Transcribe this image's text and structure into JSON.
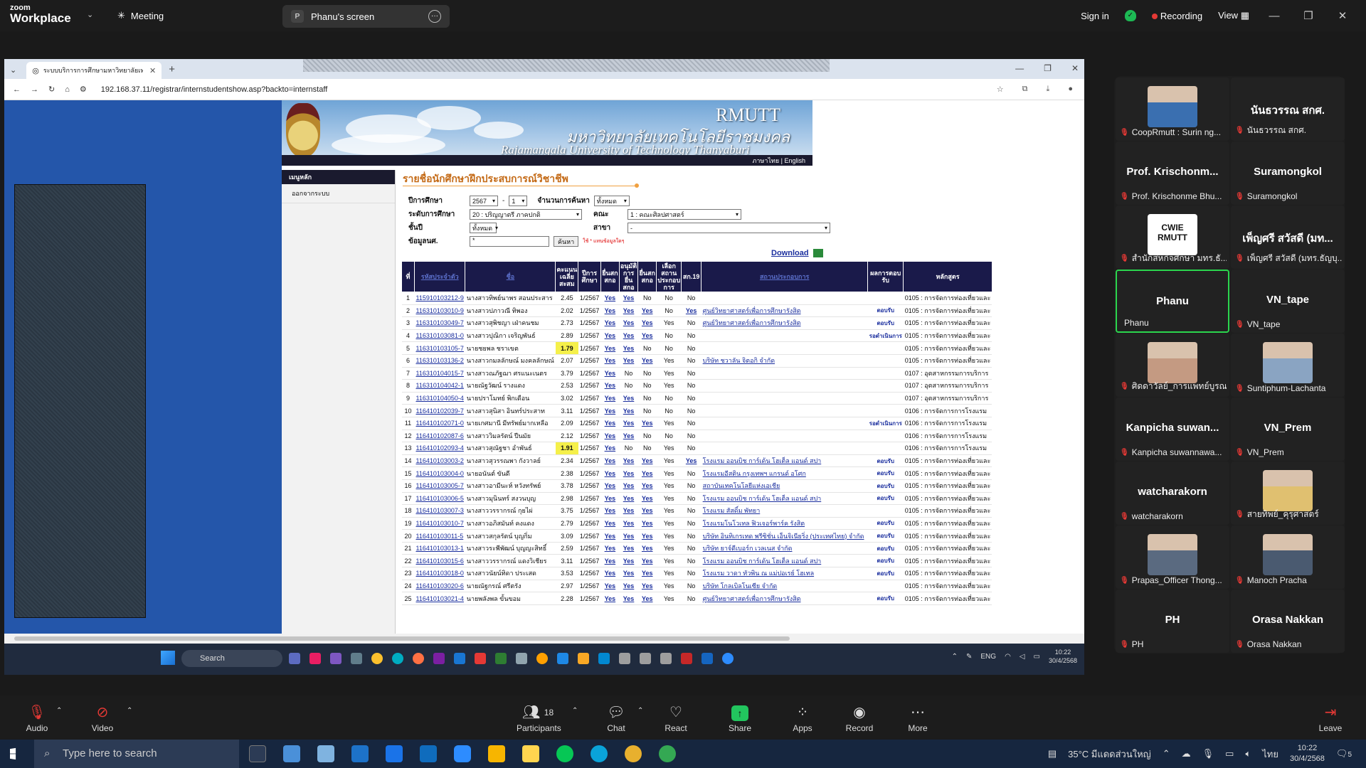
{
  "zoom": {
    "brand_top": "zoom",
    "brand_bottom": "Workplace",
    "meeting_label": "Meeting",
    "share_badge": "P",
    "share_title": "Phanu's screen",
    "signin": "Sign in",
    "recording": "Recording",
    "view": "View",
    "controls": {
      "audio": "Audio",
      "video": "Video",
      "participants": "Participants",
      "participants_count": "18",
      "chat": "Chat",
      "react": "React",
      "share": "Share",
      "apps": "Apps",
      "record": "Record",
      "more": "More",
      "leave": "Leave"
    }
  },
  "browser": {
    "tab_title": "ระบบบริการการศึกษามหาวิทยาลัยเทคโ...",
    "url": "192.168.37.11/registrar/internstudentshow.asp?backto=internstaff"
  },
  "site": {
    "brand_en": "RMUTT",
    "brand_th": "มหาวิทยาลัยเทคโนโลยีราชมงคลธัญบุรี",
    "brand_full": "Rajamangala University of Technology Thanyaburi",
    "nav_lang": "ภาษาไทย | English",
    "menu_main": "เมนูหลัก",
    "menu_logout": "ออกจากระบบ",
    "page_title": "รายชื่อนักศึกษาฝึกประสบการณ์วิชาชีพ",
    "form": {
      "year_label": "ปีการศึกษา",
      "year": "2567",
      "sem": "1",
      "count_label": "จำนวนการค้นหา",
      "count": "ทั้งหมด",
      "level_label": "ระดับการศึกษา",
      "level": "20 : ปริญญาตรี ภาคปกติ",
      "faculty_label": "คณะ",
      "faculty": "1 : คณะศิลปศาสตร์",
      "grade_label": "ชั้นปี",
      "grade": "ทั้งหมด",
      "major_label": "สาขา",
      "major": "-",
      "info_label": "ข้อมูลนศ.",
      "info_value": "*",
      "search_btn": "ค้นหา",
      "note": "ใช้ * แทนข้อมูลใดๆ"
    },
    "download": "Download",
    "table": {
      "headers": [
        "ที่",
        "รหัสประจำตัว",
        "ชื่อ",
        "คะแนนเฉลี่ยสะสม",
        "ปีการศึกษา",
        "ยื่นสกสกอ",
        "อนุมัติการยื่นสกอ",
        "ยื่นสกสกอ",
        "เลือกสถานประกอบการ",
        "สก.19",
        "สถานประกอบการ",
        "ผลการตอบรับ",
        "หลักสูตร"
      ],
      "rows": [
        [
          "1",
          "115910103212-9",
          "นางสาวทิพย์นาพร สอนประสาร",
          "2.45",
          "1/2567",
          "Yes",
          "Yes",
          "No",
          "No",
          "No",
          "",
          "",
          "0105 : การจัดการท่องเที่ยวและ"
        ],
        [
          "2",
          "116310103010-9",
          "นางสาวปภาวณี ทิพอง",
          "2.02",
          "1/2567",
          "Yes",
          "Yes",
          "Yes",
          "No",
          "Yes",
          "ศูนย์วิทยาศาสตร์เพื่อการศึกษารังสิต",
          "ตอบรับ",
          "0105 : การจัดการท่องเที่ยวและ"
        ],
        [
          "3",
          "116310103049-7",
          "นางสาวสุพิชญา เฝ่าคนชม",
          "2.73",
          "1/2567",
          "Yes",
          "Yes",
          "Yes",
          "Yes",
          "No",
          "ศูนย์วิทยาศาสตร์เพื่อการศึกษารังสิต",
          "ตอบรับ",
          "0105 : การจัดการท่องเที่ยวและ"
        ],
        [
          "4",
          "116310103081-0",
          "นางสาวปุณิกา เจริญพันธ์",
          "2.89",
          "1/2567",
          "Yes",
          "Yes",
          "Yes",
          "No",
          "No",
          "",
          "รอดำเนินการ",
          "0105 : การจัดการท่องเที่ยวและ"
        ],
        [
          "5",
          "116310103105-7",
          "นายชยพล ชราเขต",
          "1.79",
          "1/2567",
          "Yes",
          "Yes",
          "No",
          "No",
          "No",
          "",
          "",
          "0105 : การจัดการท่องเที่ยวและ"
        ],
        [
          "6",
          "116310103136-2",
          "นางสาวกมลลักษณ์ มงคลลักษณ์",
          "2.07",
          "1/2567",
          "Yes",
          "Yes",
          "Yes",
          "Yes",
          "No",
          "บริษัท ชวาลัน จิตอกิ จำกัด",
          "",
          "0105 : การจัดการท่องเที่ยวและ"
        ],
        [
          "7",
          "116310104015-7",
          "นางสาวณภัฐฌา ศรแนะเนตร",
          "3.79",
          "1/2567",
          "Yes",
          "No",
          "No",
          "Yes",
          "No",
          "",
          "",
          "0107 : อุตสาหกรรมการบริการ"
        ],
        [
          "8",
          "116310104042-1",
          "นายณัฐวัฒน์ รางแดง",
          "2.53",
          "1/2567",
          "Yes",
          "No",
          "No",
          "Yes",
          "No",
          "",
          "",
          "0107 : อุตสาหกรรมการบริการ"
        ],
        [
          "9",
          "116310104050-4",
          "นายปราโมทย์ พิกเดือน",
          "3.02",
          "1/2567",
          "Yes",
          "Yes",
          "No",
          "No",
          "No",
          "",
          "",
          "0107 : อุตสาหกรรมการบริการ"
        ],
        [
          "10",
          "116410102039-7",
          "นางสาวสุนิสา อินทร์ประสาท",
          "3.11",
          "1/2567",
          "Yes",
          "Yes",
          "No",
          "No",
          "No",
          "",
          "",
          "0106 : การจัดการการโรงแรม"
        ],
        [
          "11",
          "116410102071-0",
          "นายเกศมานี มีทรัพย์มากเหลือ",
          "2.09",
          "1/2567",
          "Yes",
          "Yes",
          "Yes",
          "Yes",
          "No",
          "",
          "รอดำเนินการ",
          "0106 : การจัดการการโรงแรม"
        ],
        [
          "12",
          "116410102087-6",
          "นางสาววิมลรัตน์ ปีนมัย",
          "2.12",
          "1/2567",
          "Yes",
          "Yes",
          "No",
          "No",
          "No",
          "",
          "",
          "0106 : การจัดการการโรงแรม"
        ],
        [
          "13",
          "116410102093-4",
          "นางสาวสุณัฐชา อำพันธ์",
          "1.91",
          "1/2567",
          "Yes",
          "No",
          "No",
          "Yes",
          "No",
          "",
          "",
          "0106 : การจัดการการโรงแรม"
        ],
        [
          "14",
          "116410103003-2",
          "นางสาวสุวรรณพา กังวาลย์",
          "2.34",
          "1/2567",
          "Yes",
          "Yes",
          "Yes",
          "Yes",
          "Yes",
          "โรงแรม ออนบิช การ์เด้น โฮเต็ล แอนด์ สปา",
          "ตอบรับ",
          "0105 : การจัดการท่องเที่ยวและ"
        ],
        [
          "15",
          "116410103004-0",
          "นายอนันต์ ขันดี",
          "2.38",
          "1/2567",
          "Yes",
          "Yes",
          "Yes",
          "Yes",
          "No",
          "โรงแรมอีสติน กรุงเทพฯ แกรนด์ อโศก",
          "ตอบรับ",
          "0105 : การจัดการท่องเที่ยวและ"
        ],
        [
          "16",
          "116410103005-7",
          "นางสาวอามีนะห์ หวังทรัพย์",
          "3.78",
          "1/2567",
          "Yes",
          "Yes",
          "Yes",
          "Yes",
          "No",
          "สถาบันเทคโนโลยีแห่งเอเชีย",
          "ตอบรับ",
          "0105 : การจัดการท่องเที่ยวและ"
        ],
        [
          "17",
          "116410103006-5",
          "นางสาวมุนินทร์ สงวนบุญ",
          "2.98",
          "1/2567",
          "Yes",
          "Yes",
          "Yes",
          "Yes",
          "No",
          "โรงแรม ออนบิช การ์เด้น โฮเต็ล แอนด์ สปา",
          "ตอบรับ",
          "0105 : การจัดการท่องเที่ยวและ"
        ],
        [
          "18",
          "116410103007-3",
          "นางสาววรรากรณ์ กุยไผ่",
          "3.75",
          "1/2567",
          "Yes",
          "Yes",
          "Yes",
          "Yes",
          "No",
          "โรงแรม สัสดิ์ม พัทยา",
          "",
          "0105 : การจัดการท่องเที่ยวและ"
        ],
        [
          "19",
          "116410103010-7",
          "นางสาวอภิสมันท์ คงแดง",
          "2.79",
          "1/2567",
          "Yes",
          "Yes",
          "Yes",
          "Yes",
          "No",
          "โรงแรมโนโวเทล ฟิวเจอร์พาร์ค รังสิต",
          "ตอบรับ",
          "0105 : การจัดการท่องเที่ยวและ"
        ],
        [
          "20",
          "116410103011-5",
          "นางสาวสกุลรัตน์ บุญกิ่ม",
          "3.09",
          "1/2567",
          "Yes",
          "Yes",
          "Yes",
          "Yes",
          "No",
          "บริษัท อินทิเกรเทด พรีซิชั่น เอ็นจิเนียริ่ง (ประเทศไทย) จำกัด",
          "ตอบรับ",
          "0105 : การจัดการท่องเที่ยวและ"
        ],
        [
          "21",
          "116410103013-1",
          "นางสาวระพีพัฒน์ บุญญะสิทธิ์",
          "2.59",
          "1/2567",
          "Yes",
          "Yes",
          "Yes",
          "Yes",
          "No",
          "บริษัท ยาจ์ดีเบอร์ก เวลเนส จำกัด",
          "ตอบรับ",
          "0105 : การจัดการท่องเที่ยวและ"
        ],
        [
          "22",
          "116410103015-6",
          "นางสาววรรากรณ์ แดงวิเชียร",
          "3.11",
          "1/2567",
          "Yes",
          "Yes",
          "Yes",
          "Yes",
          "No",
          "โรงแรม ออนบิช การ์เด้น โฮเต็ล แอนด์ สปา",
          "ตอบรับ",
          "0105 : การจัดการท่องเที่ยวและ"
        ],
        [
          "23",
          "116410103018-0",
          "นางสาวนัยน์ทิดา ประเสด",
          "3.53",
          "1/2567",
          "Yes",
          "Yes",
          "Yes",
          "Yes",
          "No",
          "โรงแรม วาดา ทัวพิน ณ แม่ปอเรย์ โฮเทล",
          "ตอบรับ",
          "0105 : การจัดการท่องเที่ยวและ"
        ],
        [
          "24",
          "116410103020-6",
          "นายณัฐกรณ์ ศรีตรัง",
          "2.97",
          "1/2567",
          "Yes",
          "Yes",
          "Yes",
          "Yes",
          "No",
          "บริษัท โกลเบิลโนเซีย จำกัด",
          "",
          "0105 : การจัดการท่องเที่ยวและ"
        ],
        [
          "25",
          "116410103021-4",
          "นายพลังพล ขั้นขอม",
          "2.28",
          "1/2567",
          "Yes",
          "Yes",
          "Yes",
          "Yes",
          "No",
          "ศูนย์วิทยาศาสตร์เพื่อการศึกษารังสิต",
          "ตอบรับ",
          "0105 : การจัดการท่องเที่ยวและ"
        ]
      ]
    }
  },
  "inner_taskbar": {
    "search": "Search",
    "lang": "ENG",
    "time": "10:22",
    "date": "30/4/2568"
  },
  "participants": [
    {
      "big": "",
      "name": "CoopRmutt : Surin ng...",
      "photo": "#3a6fb0"
    },
    {
      "big": "นันธวรรณ สกศ.",
      "name": "นันธวรรณ สกศ.",
      "photo": ""
    },
    {
      "big": "Prof. Krischonm...",
      "name": "Prof. Krischonme Bhu...",
      "photo": ""
    },
    {
      "big": "Suramongkol",
      "name": "Suramongkol",
      "photo": ""
    },
    {
      "big": "",
      "name": "สำนักสหกิจศึกษา มทร.ธั...",
      "photo": "cwie"
    },
    {
      "big": "เพ็ญศรี สวัสดี (มท...",
      "name": "เพ็ญศรี สวัสดี (มทร.ธัญบุ...",
      "photo": ""
    },
    {
      "big": "Phanu",
      "name": "Phanu",
      "photo": "",
      "active": true
    },
    {
      "big": "VN_tape",
      "name": "VN_tape",
      "photo": ""
    },
    {
      "big": "",
      "name": "ศิดดาวัลย์_การแพทย์บูรณ...",
      "photo": "#c49a82"
    },
    {
      "big": "",
      "name": "Suntiphum-Lachanta",
      "photo": "#8aa4c2"
    },
    {
      "big": "Kanpicha suwan...",
      "name": "Kanpicha suwannawa...",
      "photo": ""
    },
    {
      "big": "VN_Prem",
      "name": "VN_Prem",
      "photo": ""
    },
    {
      "big": "watcharakorn",
      "name": "watcharakorn",
      "photo": ""
    },
    {
      "big": "",
      "name": "สายทิพย์_คุรุศาสตร์",
      "photo": "#e0c070"
    },
    {
      "big": "",
      "name": "Prapas_Officer Thong...",
      "photo": "#5a6a80"
    },
    {
      "big": "",
      "name": "Manoch Pracha",
      "photo": "#4a5a70"
    },
    {
      "big": "PH",
      "name": "PH",
      "photo": ""
    },
    {
      "big": "Orasa Nakkan",
      "name": "Orasa Nakkan",
      "photo": ""
    }
  ],
  "cwie_text": "CWIE RMUTT",
  "windows": {
    "search": "Type here to search",
    "weather": "35°C มีแดดส่วนใหญ่",
    "lang": "ไทย",
    "time": "10:22",
    "date": "30/4/2568",
    "notif": "5"
  }
}
